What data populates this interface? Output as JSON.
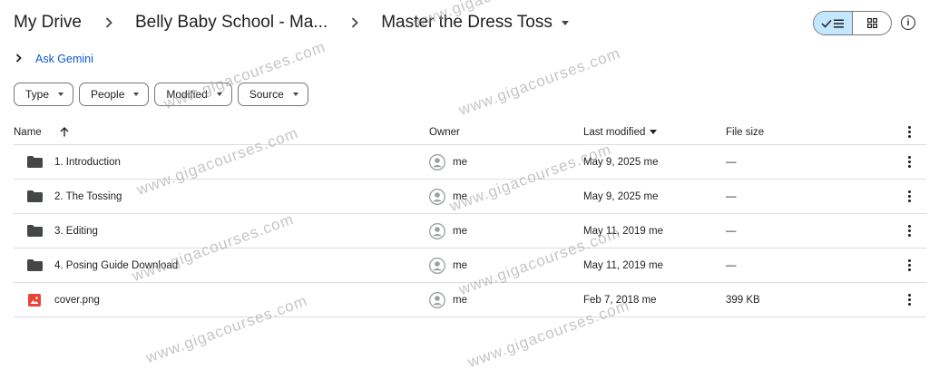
{
  "breadcrumb": {
    "root": "My Drive",
    "parent": "Belly Baby School - Ma...",
    "current": "Master the Dress Toss"
  },
  "gemini": {
    "label": "Ask Gemini"
  },
  "filters": [
    "Type",
    "People",
    "Modified",
    "Source"
  ],
  "table": {
    "headers": {
      "name": "Name",
      "owner": "Owner",
      "modified": "Last modified",
      "size": "File size"
    },
    "rows": [
      {
        "name": "1. Introduction",
        "type": "folder",
        "owner": "me",
        "modified": "May 9, 2025 me",
        "size": "—"
      },
      {
        "name": "2. The Tossing",
        "type": "folder",
        "owner": "me",
        "modified": "May 9, 2025 me",
        "size": "—"
      },
      {
        "name": "3. Editing",
        "type": "folder",
        "owner": "me",
        "modified": "May 11, 2019 me",
        "size": "—"
      },
      {
        "name": "4. Posing Guide Download",
        "type": "folder",
        "owner": "me",
        "modified": "May 11, 2019 me",
        "size": "—"
      },
      {
        "name": "cover.png",
        "type": "image",
        "owner": "me",
        "modified": "Feb 7, 2018 me",
        "size": "399 KB"
      }
    ]
  },
  "watermark": "www.gigacourses.com",
  "colors": {
    "accent": "#0b57d0",
    "selected": "#c2e7ff",
    "image_icon": "#ea4335",
    "folder_icon": "#444746"
  }
}
